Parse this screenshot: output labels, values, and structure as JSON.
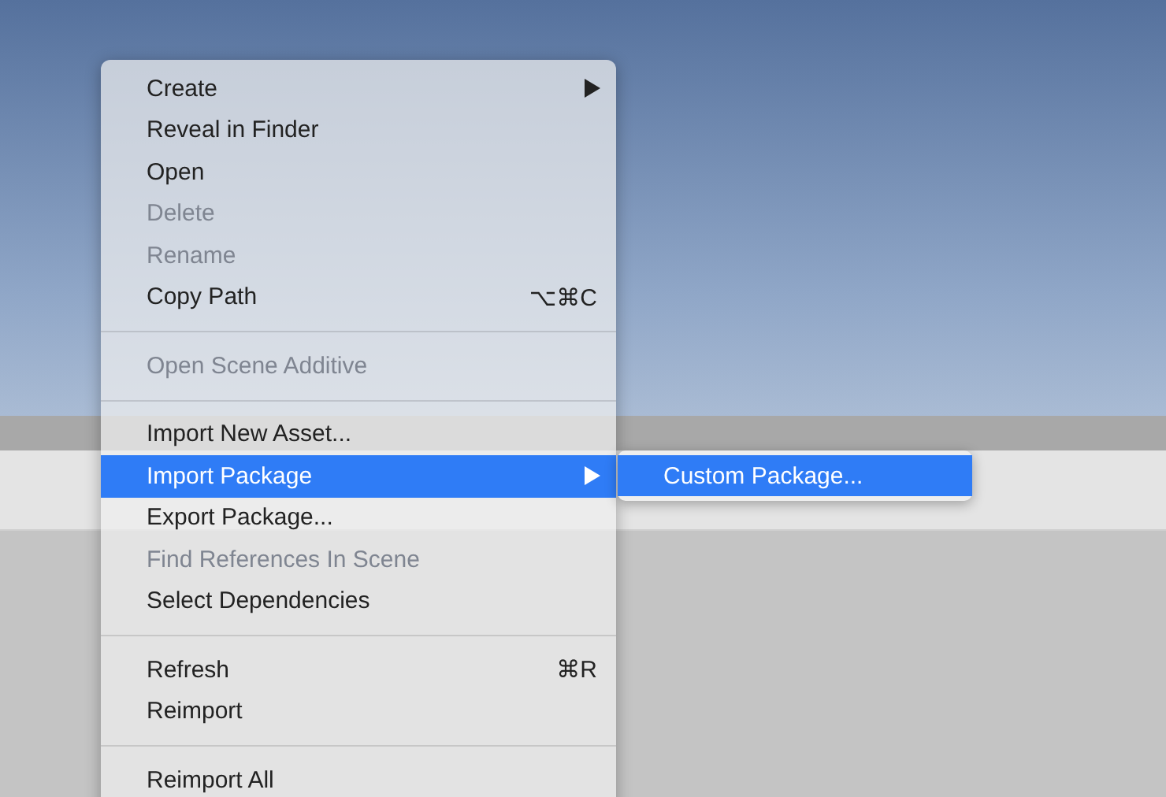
{
  "context_menu": {
    "items": [
      {
        "kind": "item",
        "label": "Create",
        "disabled": false,
        "selected": false,
        "has_submenu": true
      },
      {
        "kind": "item",
        "label": "Reveal in Finder",
        "disabled": false,
        "selected": false,
        "has_submenu": false
      },
      {
        "kind": "item",
        "label": "Open",
        "disabled": false,
        "selected": false,
        "has_submenu": false
      },
      {
        "kind": "item",
        "label": "Delete",
        "disabled": true,
        "selected": false,
        "has_submenu": false
      },
      {
        "kind": "item",
        "label": "Rename",
        "disabled": true,
        "selected": false,
        "has_submenu": false
      },
      {
        "kind": "item",
        "label": "Copy Path",
        "shortcut": "⌥⌘C",
        "disabled": false,
        "selected": false,
        "has_submenu": false
      },
      {
        "kind": "separator"
      },
      {
        "kind": "item",
        "label": "Open Scene Additive",
        "disabled": true,
        "selected": false,
        "has_submenu": false
      },
      {
        "kind": "separator"
      },
      {
        "kind": "item",
        "label": "Import New Asset...",
        "disabled": false,
        "selected": false,
        "has_submenu": false
      },
      {
        "kind": "item",
        "label": "Import Package",
        "disabled": false,
        "selected": true,
        "has_submenu": true
      },
      {
        "kind": "item",
        "label": "Export Package...",
        "disabled": false,
        "selected": false,
        "has_submenu": false
      },
      {
        "kind": "item",
        "label": "Find References In Scene",
        "disabled": true,
        "selected": false,
        "has_submenu": false
      },
      {
        "kind": "item",
        "label": "Select Dependencies",
        "disabled": false,
        "selected": false,
        "has_submenu": false
      },
      {
        "kind": "separator"
      },
      {
        "kind": "item",
        "label": "Refresh",
        "shortcut": "⌘R",
        "disabled": false,
        "selected": false,
        "has_submenu": false
      },
      {
        "kind": "item",
        "label": "Reimport",
        "disabled": false,
        "selected": false,
        "has_submenu": false
      },
      {
        "kind": "separator"
      },
      {
        "kind": "item",
        "label": "Reimport All",
        "disabled": false,
        "selected": false,
        "has_submenu": false
      }
    ]
  },
  "submenu": {
    "items": [
      {
        "label": "Custom Package...",
        "selected": true
      }
    ]
  }
}
